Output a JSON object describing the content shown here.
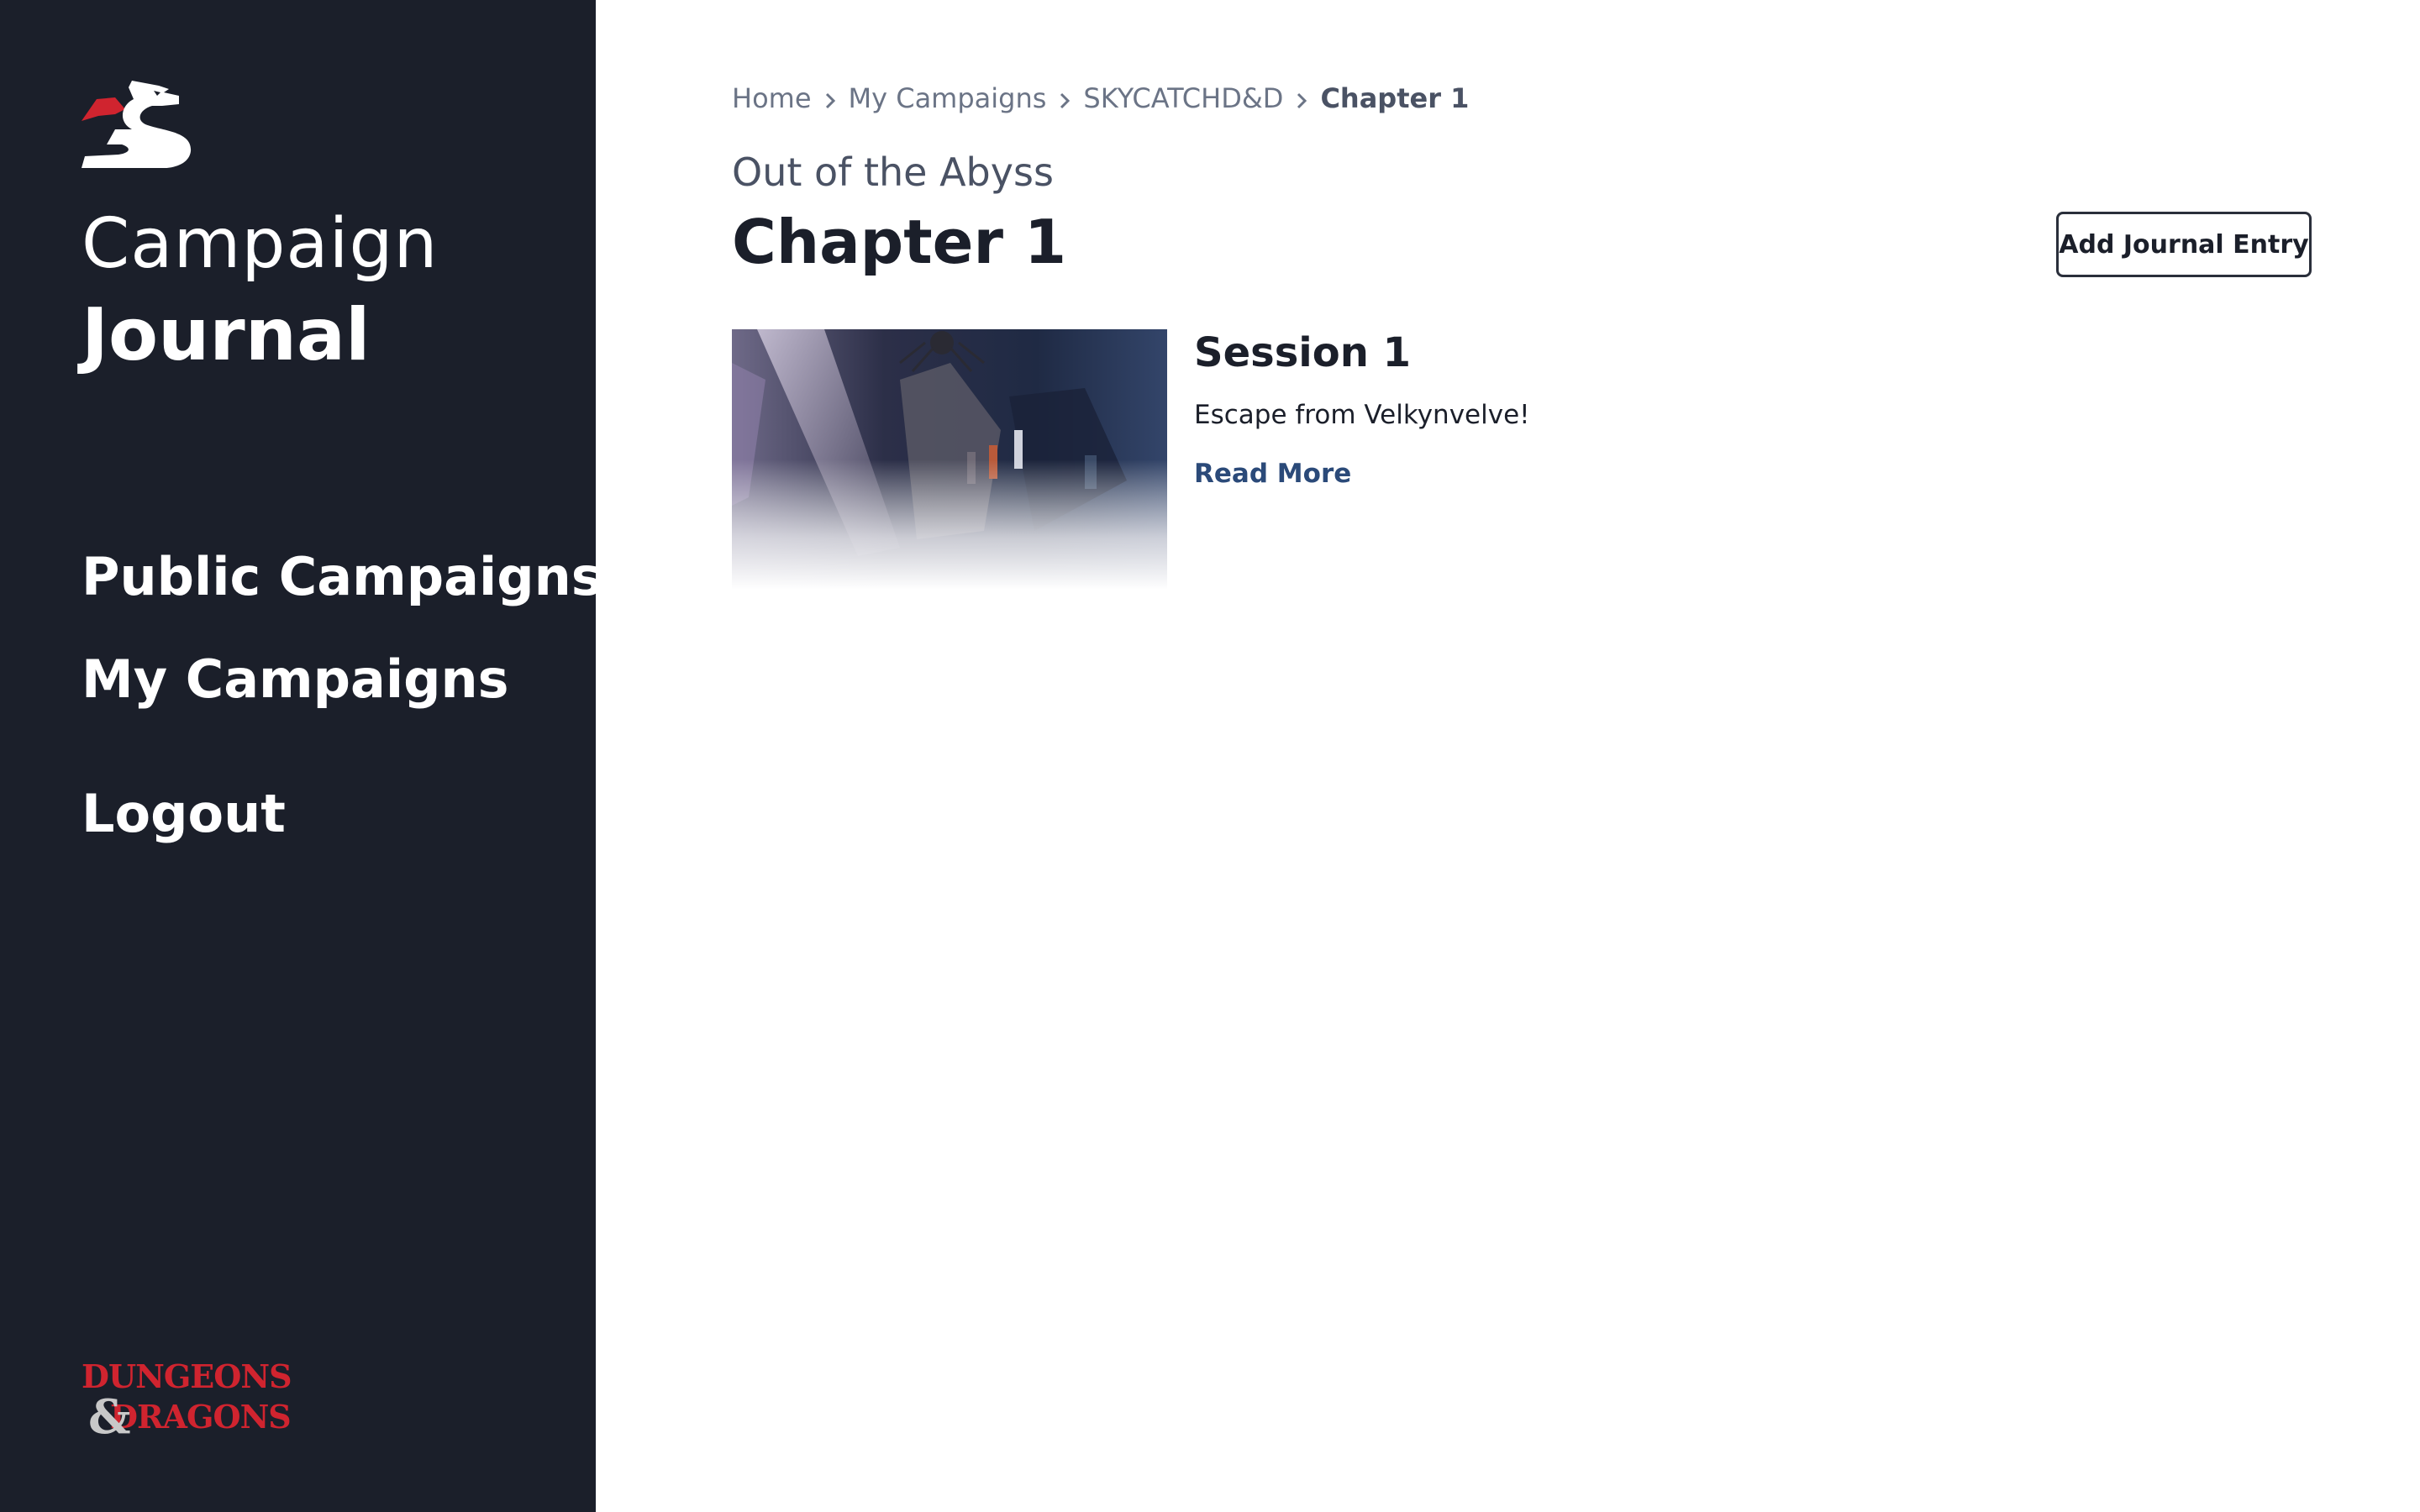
{
  "sidebar": {
    "brand_line1": "Campaign",
    "brand_line2": "Journal",
    "nav": {
      "public": "Public Campaigns",
      "mine": "My Campaigns",
      "logout": "Logout"
    },
    "footer_logo_text": "DUNGEONS & DRAGONS"
  },
  "breadcrumb": {
    "items": [
      "Home",
      "My Campaigns",
      "SKYCATCHD&D",
      "Chapter 1"
    ]
  },
  "header": {
    "subtitle": "Out of the Abyss",
    "title": "Chapter 1",
    "add_button": "Add Journal Entry"
  },
  "entries": [
    {
      "title": "Session 1",
      "description": "Escape from Velkynvelve!",
      "link": "Read More"
    }
  ],
  "colors": {
    "sidebar_bg": "#1b1f2a",
    "accent_red": "#d0242f",
    "link_blue": "#2b4a79"
  }
}
